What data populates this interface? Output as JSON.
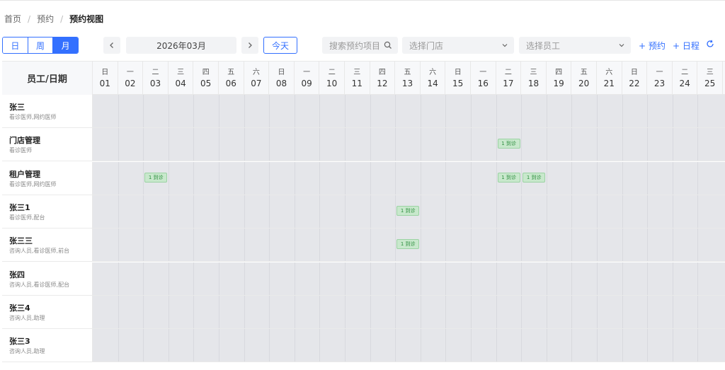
{
  "breadcrumb": [
    "首页",
    "预约",
    "预约视图"
  ],
  "toolbar": {
    "view_modes": [
      {
        "label": "日",
        "active": false
      },
      {
        "label": "周",
        "active": false
      },
      {
        "label": "月",
        "active": true
      }
    ],
    "prev_icon": "chevron-left-icon",
    "next_icon": "chevron-right-icon",
    "current_month": "2026年03月",
    "today_label": "今天",
    "search_placeholder": "搜索预约项目",
    "store_placeholder": "选择门店",
    "employee_placeholder": "选择员工",
    "add_appointment": "+ 预约",
    "add_schedule": "+ 日程",
    "refresh_icon": "refresh-icon"
  },
  "grid": {
    "corner_label": "员工/日期",
    "days": [
      {
        "weekday": "日",
        "date": "01"
      },
      {
        "weekday": "一",
        "date": "02"
      },
      {
        "weekday": "二",
        "date": "03"
      },
      {
        "weekday": "三",
        "date": "04"
      },
      {
        "weekday": "四",
        "date": "05"
      },
      {
        "weekday": "五",
        "date": "06"
      },
      {
        "weekday": "六",
        "date": "07"
      },
      {
        "weekday": "日",
        "date": "08"
      },
      {
        "weekday": "一",
        "date": "09"
      },
      {
        "weekday": "二",
        "date": "10"
      },
      {
        "weekday": "三",
        "date": "11"
      },
      {
        "weekday": "四",
        "date": "12"
      },
      {
        "weekday": "五",
        "date": "13"
      },
      {
        "weekday": "六",
        "date": "14"
      },
      {
        "weekday": "日",
        "date": "15"
      },
      {
        "weekday": "一",
        "date": "16"
      },
      {
        "weekday": "二",
        "date": "17"
      },
      {
        "weekday": "三",
        "date": "18"
      },
      {
        "weekday": "四",
        "date": "19"
      },
      {
        "weekday": "五",
        "date": "20"
      },
      {
        "weekday": "六",
        "date": "21"
      },
      {
        "weekday": "日",
        "date": "22"
      },
      {
        "weekday": "一",
        "date": "23"
      },
      {
        "weekday": "二",
        "date": "24"
      },
      {
        "weekday": "三",
        "date": "25"
      }
    ],
    "employees": [
      {
        "name": "张三",
        "roles": "看诊医师,网约医师",
        "appointments": []
      },
      {
        "name": "门店管理",
        "roles": "看诊医师",
        "appointments": [
          {
            "date": "17",
            "label": "1 到诊"
          }
        ]
      },
      {
        "name": "租户管理",
        "roles": "看诊医师,网约医师",
        "appointments": [
          {
            "date": "03",
            "label": "1 到诊"
          },
          {
            "date": "17",
            "label": "1 到诊"
          },
          {
            "date": "18",
            "label": "1 到诊"
          }
        ]
      },
      {
        "name": "张三1",
        "roles": "看诊医师,配台",
        "appointments": [
          {
            "date": "13",
            "label": "1 到诊"
          }
        ]
      },
      {
        "name": "张三三",
        "roles": "咨询人员,看诊医师,前台",
        "appointments": [
          {
            "date": "13",
            "label": "1 到诊"
          }
        ]
      },
      {
        "name": "张四",
        "roles": "咨询人员,看诊医师,配台",
        "appointments": []
      },
      {
        "name": "张三4",
        "roles": "咨询人员,助理",
        "appointments": []
      },
      {
        "name": "张三3",
        "roles": "咨询人员,助理",
        "appointments": []
      }
    ]
  }
}
